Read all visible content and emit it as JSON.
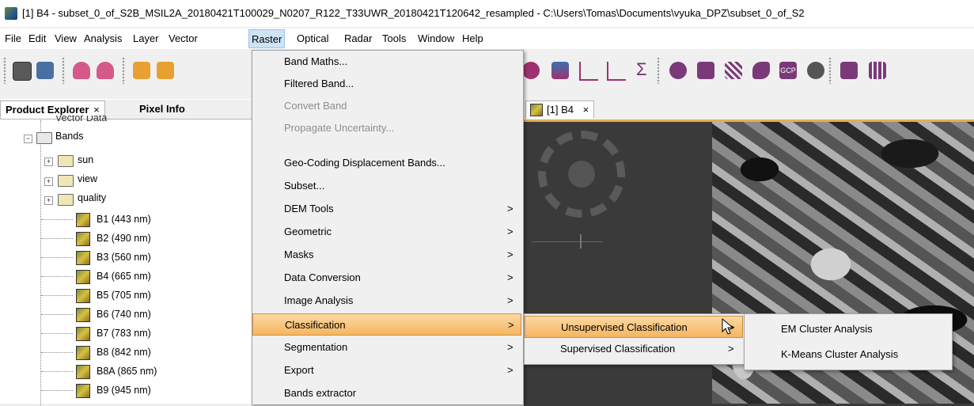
{
  "window": {
    "title": "[1] B4 - subset_0_of_S2B_MSIL2A_20180421T100029_N0207_R122_T33UWR_20180421T120642_resampled - C:\\Users\\Tomas\\Documents\\vyuka_DPZ\\subset_0_of_S2"
  },
  "menubar": {
    "items": [
      "File",
      "Edit",
      "View",
      "Analysis",
      "Layer",
      "Vector",
      "Raster",
      "Optical",
      "Radar",
      "Tools",
      "Window",
      "Help"
    ],
    "active": "Raster"
  },
  "left_panel": {
    "tabs": [
      {
        "label": "Product Explorer",
        "close": "×"
      },
      {
        "label": "Pixel Info"
      }
    ],
    "tree": {
      "partial_top": "Vector Data",
      "bands_folder": "Bands",
      "subfolders": [
        "sun",
        "view",
        "quality"
      ],
      "bands": [
        "B1 (443 nm)",
        "B2 (490 nm)",
        "B3 (560 nm)",
        "B4 (665 nm)",
        "B5 (705 nm)",
        "B6 (740 nm)",
        "B7 (783 nm)",
        "B8 (842 nm)",
        "B8A (865 nm)",
        "B9 (945 nm)"
      ]
    }
  },
  "view": {
    "tab_label": "[1] B4",
    "tab_close": "×"
  },
  "raster_menu": {
    "items": [
      {
        "label": "Band Maths...",
        "submenu": false,
        "disabled": false
      },
      {
        "label": "Filtered Band...",
        "submenu": false,
        "disabled": false
      },
      {
        "label": "Convert Band",
        "submenu": false,
        "disabled": true
      },
      {
        "label": "Propagate Uncertainty...",
        "submenu": false,
        "disabled": true
      },
      {
        "label": "Geo-Coding Displacement Bands...",
        "submenu": false,
        "disabled": false
      },
      {
        "label": "Subset...",
        "submenu": false,
        "disabled": false
      },
      {
        "label": "DEM Tools",
        "submenu": true,
        "disabled": false
      },
      {
        "label": "Geometric",
        "submenu": true,
        "disabled": false
      },
      {
        "label": "Masks",
        "submenu": true,
        "disabled": false
      },
      {
        "label": "Data Conversion",
        "submenu": true,
        "disabled": false
      },
      {
        "label": "Image Analysis",
        "submenu": true,
        "disabled": false
      },
      {
        "label": "Classification",
        "submenu": true,
        "disabled": false,
        "highlighted": true
      },
      {
        "label": "Segmentation",
        "submenu": true,
        "disabled": false
      },
      {
        "label": "Export",
        "submenu": true,
        "disabled": false
      },
      {
        "label": "Bands extractor",
        "submenu": false,
        "disabled": false
      }
    ],
    "arrow": ">"
  },
  "classification_submenu": {
    "items": [
      {
        "label": "Unsupervised Classification",
        "highlighted": true
      },
      {
        "label": "Supervised Classification",
        "highlighted": false
      }
    ],
    "arrow": ">"
  },
  "unsupervised_submenu": {
    "items": [
      "EM Cluster Analysis",
      "K-Means Cluster Analysis"
    ]
  },
  "toolbar": {
    "gcp_label": "GCP",
    "sigma": "Σ"
  },
  "colors": {
    "highlight_top": "#fbd9a2",
    "highlight_bottom": "#f5b560",
    "menubar_active": "#cfe3f6",
    "view_border": "#e0b050"
  }
}
